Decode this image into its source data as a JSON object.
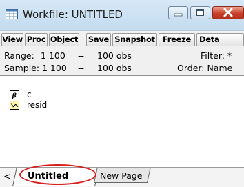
{
  "window": {
    "title": "Workfile: UNTITLED",
    "icons": {
      "app": "spreadsheet-grid-icon",
      "minimize": "minimize-icon",
      "maximize": "maximize-icon",
      "close": "close-icon"
    },
    "close_color": "#c9412a"
  },
  "toolbar": {
    "buttons": [
      "View",
      "Proc",
      "Object",
      "Save",
      "Snapshot",
      "Freeze",
      "Deta"
    ]
  },
  "info": {
    "range_label": "Range:",
    "range_value": "1 100",
    "range_sep": "--",
    "range_obs": "100 obs",
    "filter": "Filter: *",
    "sample_label": "Sample:",
    "sample_value": "1 100",
    "sample_sep": "--",
    "sample_obs": "100 obs",
    "order": "Order: Name"
  },
  "objects": [
    {
      "name": "c",
      "icon": "coefficient-beta-icon"
    },
    {
      "name": "resid",
      "icon": "series-line-icon"
    }
  ],
  "tabs": {
    "nav_icon": "tab-scroll-left-icon",
    "nav_glyph": "<",
    "active": "Untitled",
    "other": "New Page"
  },
  "annotation_color": "#d91c1c"
}
